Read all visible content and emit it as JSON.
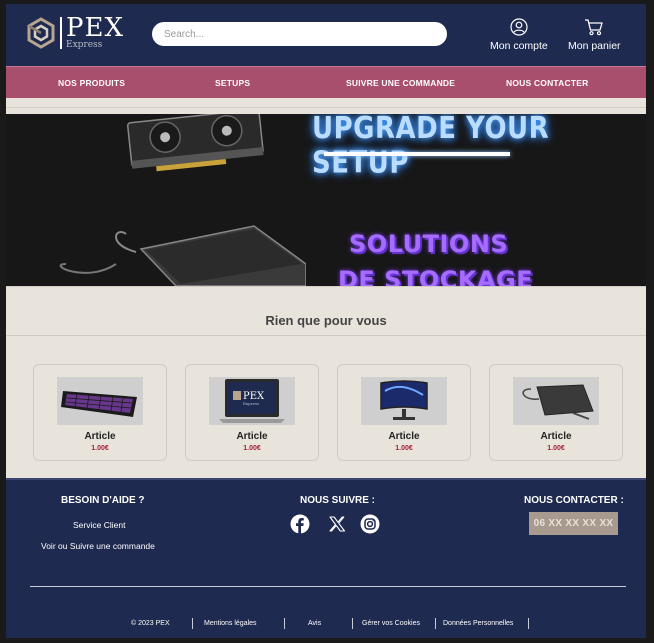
{
  "header": {
    "logo_text": "PEX",
    "logo_sub": "Express",
    "search_placeholder": "Search...",
    "account_label": "Mon compte",
    "cart_label": "Mon panier"
  },
  "nav": {
    "items": [
      "NOS PRODUITS",
      "SETUPS",
      "SUIVRE UNE COMMANDE",
      "NOUS CONTACTER"
    ]
  },
  "banner": {
    "title": "UPGRADE YOUR SETUP",
    "line1": "SOLUTIONS",
    "line2": "DE STOCKAGE"
  },
  "featured": {
    "title": "Rien que pour vous",
    "products": [
      {
        "name": "Article",
        "price": "1.00€",
        "icon": "keyboard-icon"
      },
      {
        "name": "Article",
        "price": "1.00€",
        "icon": "laptop-icon"
      },
      {
        "name": "Article",
        "price": "1.00€",
        "icon": "monitor-icon"
      },
      {
        "name": "Article",
        "price": "1.00€",
        "icon": "hard-drive-icon"
      }
    ]
  },
  "footer": {
    "help_title": "BESOIN D'AIDE ?",
    "help_links": [
      "Service Client",
      "Voir ou Suivre une commande"
    ],
    "follow_title": "NOUS SUIVRE :",
    "socials": [
      "facebook-icon",
      "x-icon",
      "instagram-icon"
    ],
    "contact_title": "NOUS CONTACTER :",
    "phone": "06 XX XX XX XX",
    "legal": [
      "© 2023 PEX",
      "Mentions légales",
      "Avis",
      "Gérer vos Cookies",
      "Données Personnelles"
    ]
  },
  "colors": {
    "header_bg": "#1e2a4f",
    "nav_bg": "#a94f6e",
    "page_bg": "#e8e4dc",
    "price": "#a3223a",
    "phone_bg": "#a89a8e"
  }
}
